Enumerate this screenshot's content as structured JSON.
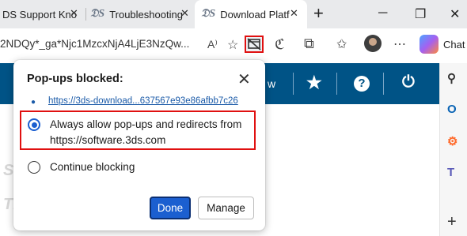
{
  "tabs": [
    {
      "label": "DS Support Kno",
      "close": "✕"
    },
    {
      "label": "Troubleshooting",
      "close": "✕"
    },
    {
      "label": "Download Platf",
      "close": "✕",
      "active": true
    }
  ],
  "new_tab": "+",
  "window": {
    "minimize": "─",
    "restore": "❐",
    "close": "✕"
  },
  "address": {
    "url": "2NDQy*_ga*Njc1MzcxNjA4LjE3NzQw...",
    "read_aloud": "A⁾"
  },
  "chat_label": "Chat",
  "sidebar_plus": "+",
  "ghost_texts": [
    "S",
    "TE"
  ],
  "site_nav": {
    "partial_text": "w"
  },
  "popup": {
    "title": "Pop-ups blocked:",
    "close": "✕",
    "link": "https://3ds-download...637567e93e86afbb7c26",
    "options": [
      {
        "line1": "Always allow pop-ups and redirects from",
        "line2": "https://software.3ds.com",
        "selected": true
      },
      {
        "line1": "Continue blocking",
        "selected": false
      }
    ],
    "done_label": "Done",
    "manage_label": "Manage"
  },
  "colors": {
    "brand_header": "#005386",
    "accent": "#1b5fd0",
    "highlight": "#e01010",
    "link": "#1a5aa8"
  }
}
